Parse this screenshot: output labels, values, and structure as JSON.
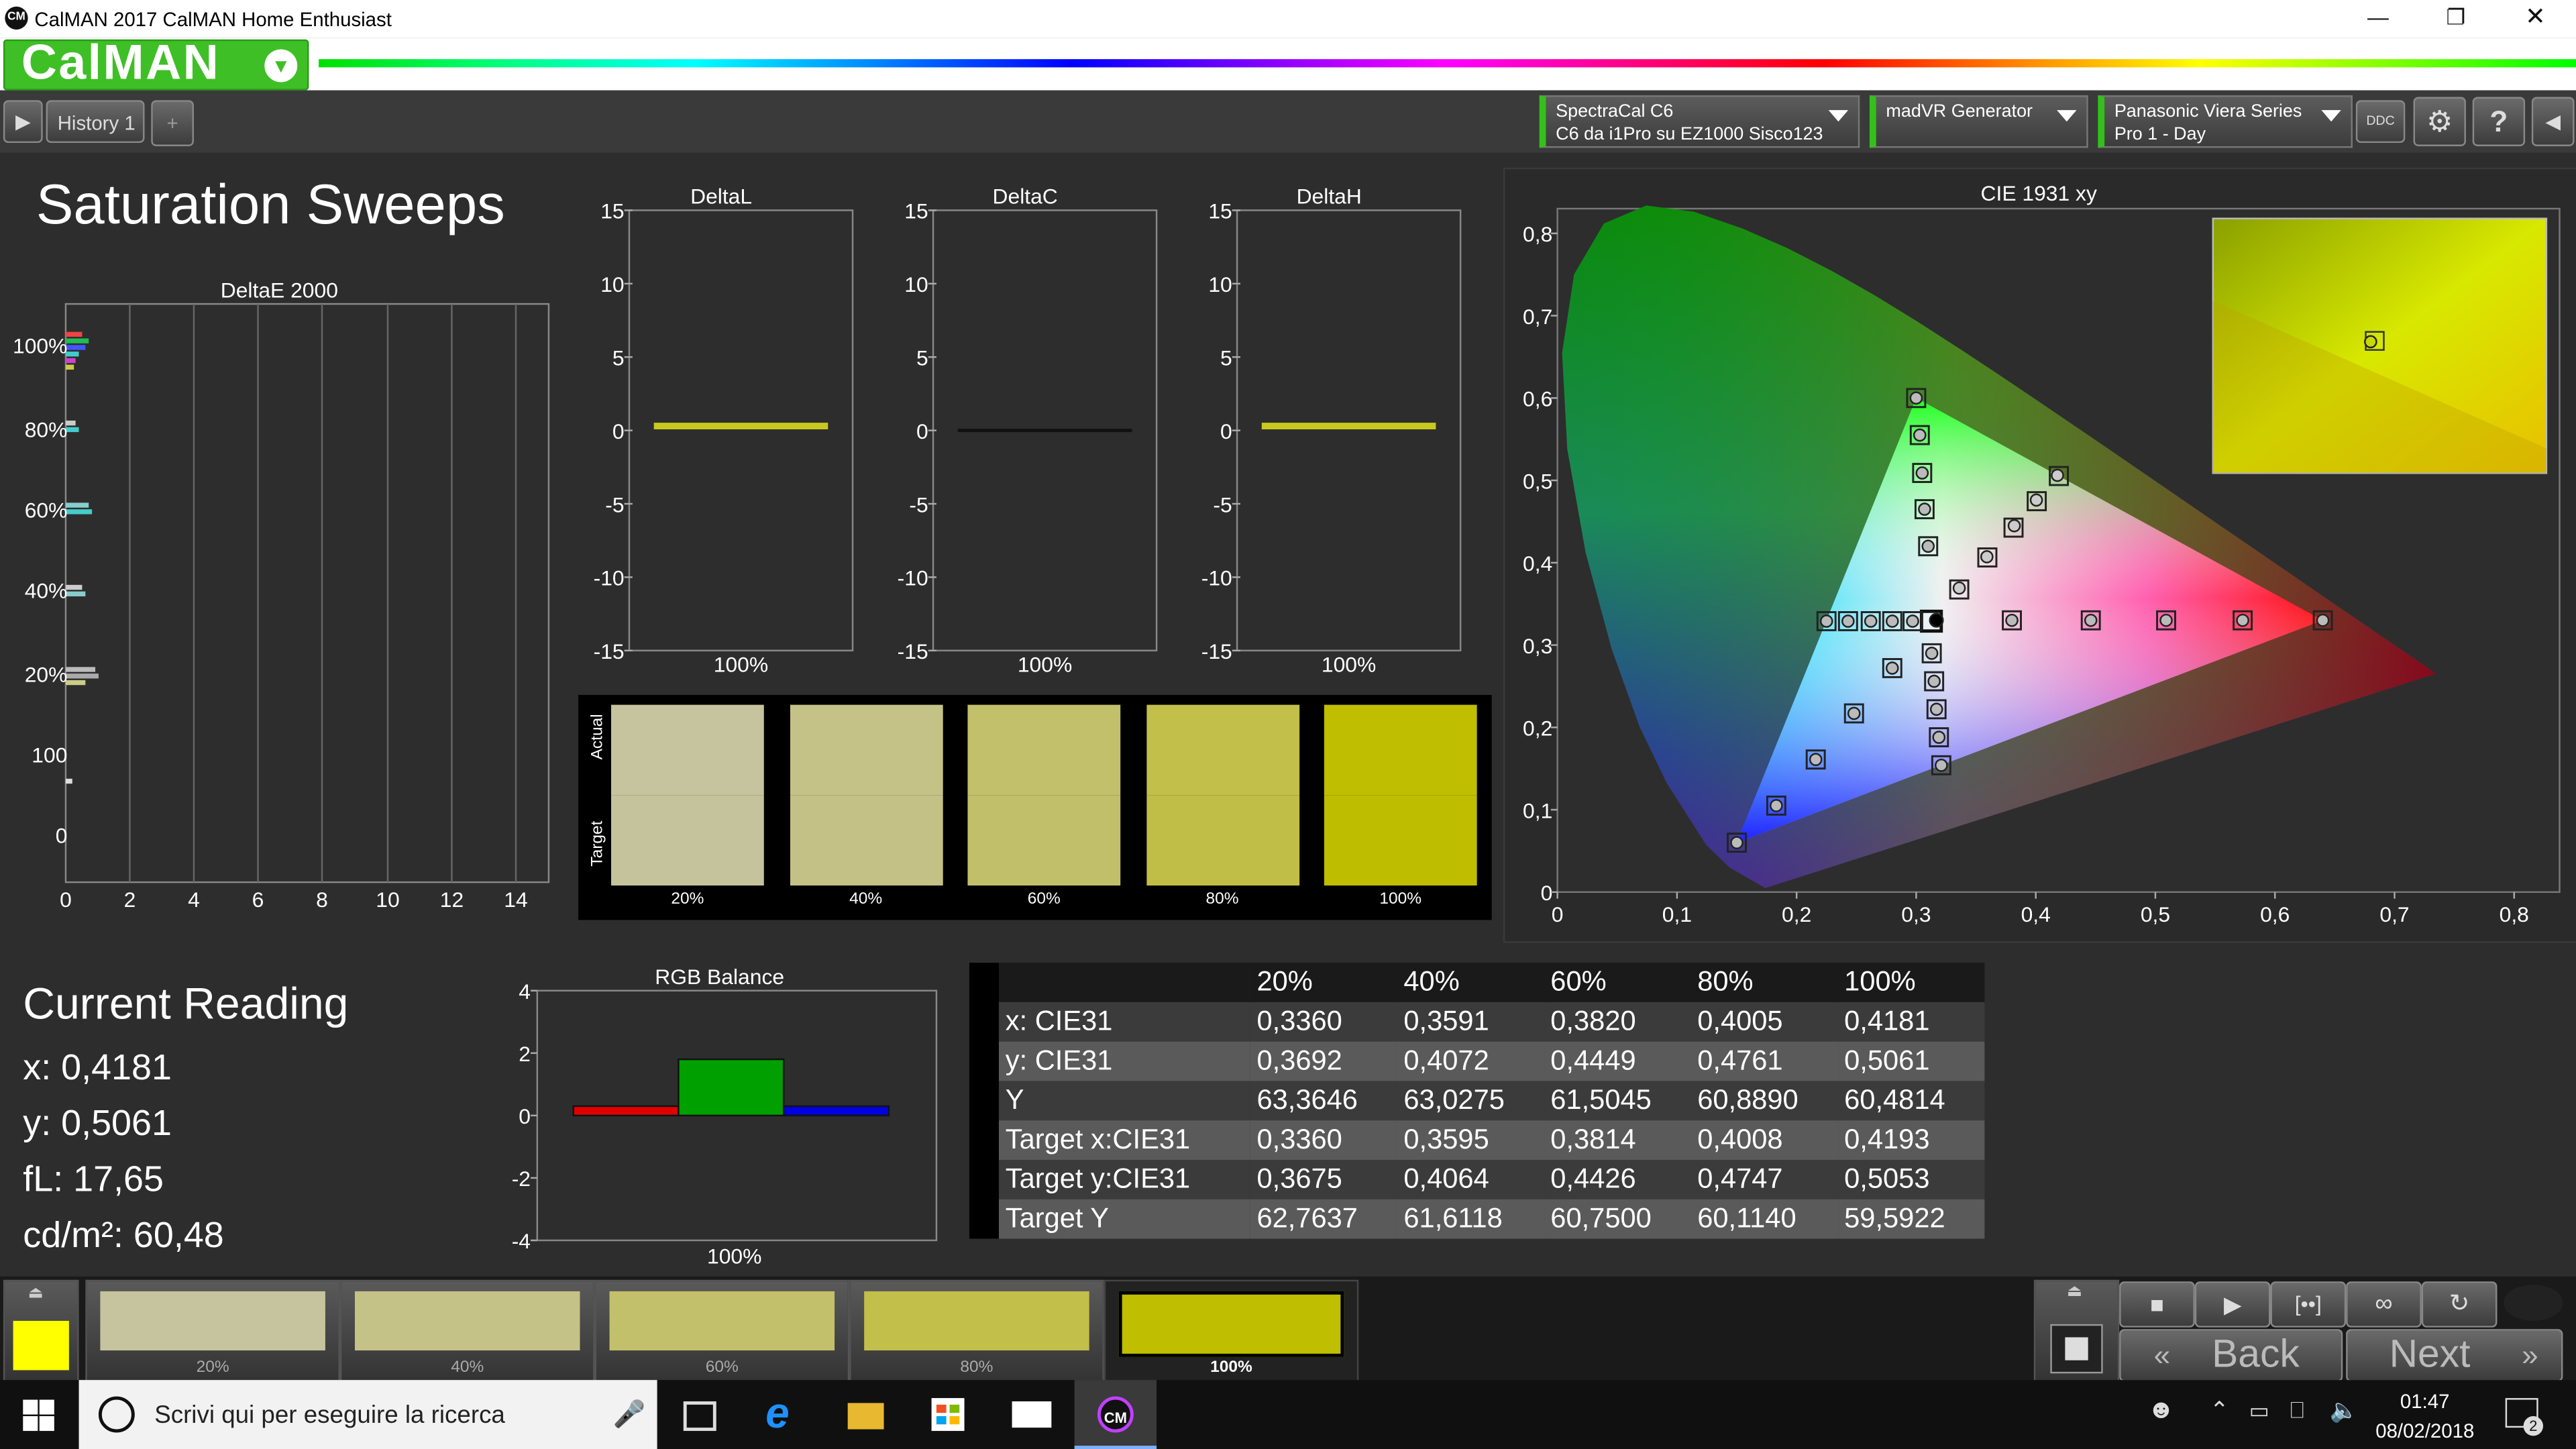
{
  "window": {
    "title": "CalMAN 2017 CalMAN Home Enthusiast",
    "app_logo": "CM"
  },
  "ribbon": {
    "brand": "CalMAN"
  },
  "tabs": {
    "history_tab": "History 1",
    "add_tab": "+"
  },
  "devices": [
    {
      "line1": "SpectraCal C6",
      "line2": "C6 da i1Pro su EZ1000 Sisco123"
    },
    {
      "line1": "madVR Generator",
      "line2": ""
    },
    {
      "line1": "Panasonic Viera Series",
      "line2": "Pro 1 - Day"
    }
  ],
  "toolbar_icons": {
    "ddc": "DDC",
    "settings": "gear-icon",
    "help": "?"
  },
  "page": {
    "title": "Saturation Sweeps"
  },
  "deltae_chart": {
    "title": "DeltaE 2000",
    "x_ticks": [
      "0",
      "2",
      "4",
      "6",
      "8",
      "10",
      "12",
      "14"
    ],
    "y_ticks": [
      "100%",
      "80%",
      "60%",
      "40%",
      "20%",
      "100",
      "0"
    ]
  },
  "delta_charts": [
    {
      "title": "DeltaL",
      "xlabel": "100%",
      "value": 0.3,
      "line_color": "#c8c81e"
    },
    {
      "title": "DeltaC",
      "xlabel": "100%",
      "value": 0.0,
      "line_color": "#111111"
    },
    {
      "title": "DeltaH",
      "xlabel": "100%",
      "value": 0.3,
      "line_color": "#c8c81e"
    }
  ],
  "delta_y_ticks": [
    "15",
    "10",
    "5",
    "0",
    "-5",
    "-10",
    "-15"
  ],
  "swatch_panel": {
    "actual_label": "Actual",
    "target_label": "Target",
    "items": [
      {
        "label": "20%",
        "actual": "#c5c49e",
        "target": "#c4c39c"
      },
      {
        "label": "40%",
        "actual": "#c4c287",
        "target": "#c3c185"
      },
      {
        "label": "60%",
        "actual": "#c3c06c",
        "target": "#c2bf6a"
      },
      {
        "label": "80%",
        "actual": "#c2bf4b",
        "target": "#c1be48"
      },
      {
        "label": "100%",
        "actual": "#c0be00",
        "target": "#bfbd00"
      }
    ]
  },
  "cie_chart": {
    "title": "CIE 1931 xy",
    "x_ticks": [
      "0",
      "0,1",
      "0,2",
      "0,3",
      "0,4",
      "0,5",
      "0,6",
      "0,7",
      "0,8"
    ],
    "y_ticks": [
      "0,8",
      "0,7",
      "0,6",
      "0,5",
      "0,4",
      "0,3",
      "0,2",
      "0,1",
      "0"
    ]
  },
  "chart_data": [
    {
      "type": "bar",
      "title": "RGB Balance",
      "categories": [
        "100%"
      ],
      "series": [
        {
          "color": "#e00000",
          "values": [
            0.3
          ]
        },
        {
          "color": "#00a000",
          "values": [
            1.8
          ]
        },
        {
          "color": "#0000e0",
          "values": [
            0.3
          ]
        }
      ],
      "ylim": [
        -4,
        4
      ],
      "y_ticks": [
        "4",
        "2",
        "0",
        "-2",
        "-4"
      ]
    },
    {
      "type": "scatter",
      "title": "CIE 1931 xy",
      "xlim": [
        0,
        0.8
      ],
      "ylim": [
        0,
        0.8
      ],
      "white_point": [
        0.3127,
        0.329
      ],
      "targets": [
        [
          0.3127,
          0.329
        ],
        [
          0.64,
          0.33
        ],
        [
          0.573,
          0.33
        ],
        [
          0.509,
          0.33
        ],
        [
          0.446,
          0.33
        ],
        [
          0.38,
          0.33
        ],
        [
          0.3,
          0.6
        ],
        [
          0.303,
          0.555
        ],
        [
          0.305,
          0.509
        ],
        [
          0.307,
          0.465
        ],
        [
          0.31,
          0.42
        ],
        [
          0.15,
          0.06
        ],
        [
          0.183,
          0.105
        ],
        [
          0.216,
          0.161
        ],
        [
          0.248,
          0.217
        ],
        [
          0.28,
          0.272
        ],
        [
          0.225,
          0.329
        ],
        [
          0.243,
          0.329
        ],
        [
          0.262,
          0.329
        ],
        [
          0.28,
          0.329
        ],
        [
          0.297,
          0.329
        ],
        [
          0.321,
          0.154
        ],
        [
          0.319,
          0.188
        ],
        [
          0.317,
          0.222
        ],
        [
          0.315,
          0.256
        ],
        [
          0.313,
          0.29
        ],
        [
          0.4193,
          0.5053
        ],
        [
          0.4008,
          0.4747
        ],
        [
          0.3814,
          0.4426
        ],
        [
          0.3595,
          0.4064
        ],
        [
          0.336,
          0.3675
        ]
      ],
      "measured": [
        [
          0.3169,
          0.3301
        ],
        [
          0.4181,
          0.5061
        ],
        [
          0.4005,
          0.4761
        ],
        [
          0.382,
          0.4449
        ],
        [
          0.3591,
          0.4072
        ],
        [
          0.336,
          0.3692
        ]
      ]
    }
  ],
  "rgb_balance": {
    "title": "RGB Balance",
    "xlabel": "100%"
  },
  "current_reading": {
    "title": "Current Reading",
    "x": "x: 0,4181",
    "y": "y: 0,5061",
    "fl": "fL: 17,65",
    "cdm2": "cd/m²: 60,48"
  },
  "data_table": {
    "columns": [
      "20%",
      "40%",
      "60%",
      "80%",
      "100%"
    ],
    "rows": [
      {
        "label": "x: CIE31",
        "values": [
          "0,3360",
          "0,3591",
          "0,3820",
          "0,4005",
          "0,4181"
        ]
      },
      {
        "label": "y: CIE31",
        "values": [
          "0,3692",
          "0,4072",
          "0,4449",
          "0,4761",
          "0,5061"
        ]
      },
      {
        "label": "Y",
        "values": [
          "63,3646",
          "63,0275",
          "61,5045",
          "60,8890",
          "60,4814"
        ]
      },
      {
        "label": "Target x:CIE31",
        "values": [
          "0,3360",
          "0,3595",
          "0,3814",
          "0,4008",
          "0,4193"
        ]
      },
      {
        "label": "Target y:CIE31",
        "values": [
          "0,3675",
          "0,4064",
          "0,4426",
          "0,4747",
          "0,5053"
        ]
      },
      {
        "label": "Target Y",
        "values": [
          "62,7637",
          "61,6118",
          "60,7500",
          "60,1140",
          "59,5922"
        ]
      }
    ]
  },
  "bottom_swatches": [
    {
      "label": "20%",
      "color": "#c5c49e"
    },
    {
      "label": "40%",
      "color": "#c4c287"
    },
    {
      "label": "60%",
      "color": "#c3c06c"
    },
    {
      "label": "80%",
      "color": "#c2bf4b"
    },
    {
      "label": "100%",
      "color": "#c0be00"
    }
  ],
  "current_swatch_color": "#ffff00",
  "nav": {
    "back": "Back",
    "next": "Next"
  },
  "taskbar": {
    "search_placeholder": "Scrivi qui per eseguire la ricerca",
    "time": "01:47",
    "date": "08/02/2018",
    "notifications": "2",
    "cm_app": "CM"
  }
}
